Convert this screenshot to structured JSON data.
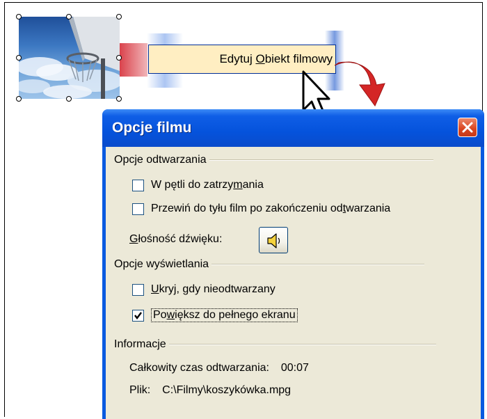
{
  "slide": {
    "context_menu_item": {
      "label_prefix": "Edytuj ",
      "label_underlined": "O",
      "label_suffix": "biekt filmowy"
    }
  },
  "dialog": {
    "title": "Opcje filmu",
    "playback_group": {
      "header": "Opcje odtwarzania",
      "loop": {
        "label_prefix": "W pętli do zatrzy",
        "label_underlined": "m",
        "label_suffix": "ania",
        "checked": false
      },
      "rewind": {
        "label_prefix": "Przewiń do tyłu film po zakończeniu od",
        "label_underlined": "t",
        "label_suffix": "warzania",
        "checked": false
      },
      "volume": {
        "label_underlined": "G",
        "label_suffix": "łośność dźwięku:"
      }
    },
    "display_group": {
      "header": "Opcje wyświetlania",
      "hide": {
        "label_underlined": "U",
        "label_suffix": "kryj, gdy nieodtwarzany",
        "checked": false
      },
      "fullscreen": {
        "label_prefix": "Po",
        "label_underlined": "w",
        "label_suffix": "iększ do pełnego ekranu",
        "checked": true
      }
    },
    "info_group": {
      "header": "Informacje",
      "total_time_label": "Całkowity czas odtwarzania:",
      "total_time_value": "00:07",
      "file_label": "Plik:",
      "file_value": "C:\\Filmy\\koszykówka.mpg"
    }
  },
  "colors": {
    "title_bar": "#0553dc",
    "dialog_body": "#ece9d8",
    "close_button": "#d9441f",
    "menu_highlight": "#ffeec2",
    "arrow": "#d42626"
  },
  "icons": [
    "speaker-icon",
    "close-icon",
    "check-icon",
    "mouse-cursor-icon",
    "curved-arrow-icon"
  ]
}
